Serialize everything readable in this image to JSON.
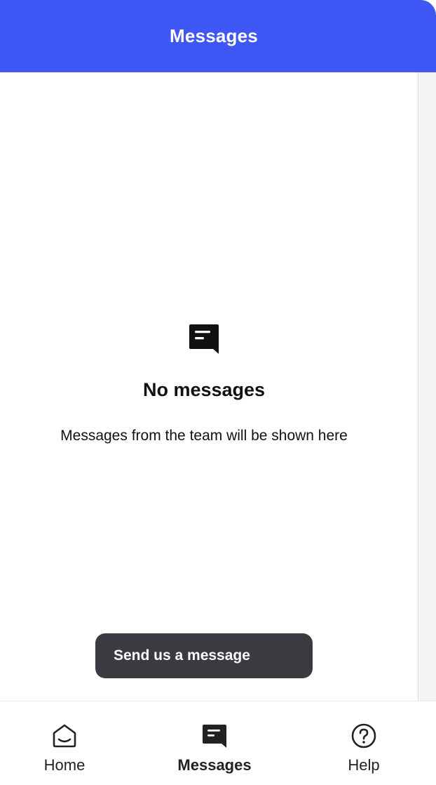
{
  "colors": {
    "header_bg": "#3f57f5",
    "header_text": "#ffffff",
    "button_bg": "#3b3a40",
    "text": "#111111"
  },
  "header": {
    "title": "Messages"
  },
  "empty_state": {
    "icon": "message-bubble-icon",
    "title": "No messages",
    "description": "Messages from the team will be shown here"
  },
  "send_button": {
    "label": "Send us a message",
    "icon": "send-arrow-icon"
  },
  "nav": {
    "items": [
      {
        "label": "Home",
        "icon": "home-icon",
        "active": false
      },
      {
        "label": "Messages",
        "icon": "messages-icon",
        "active": true
      },
      {
        "label": "Help",
        "icon": "help-icon",
        "active": false
      }
    ]
  }
}
